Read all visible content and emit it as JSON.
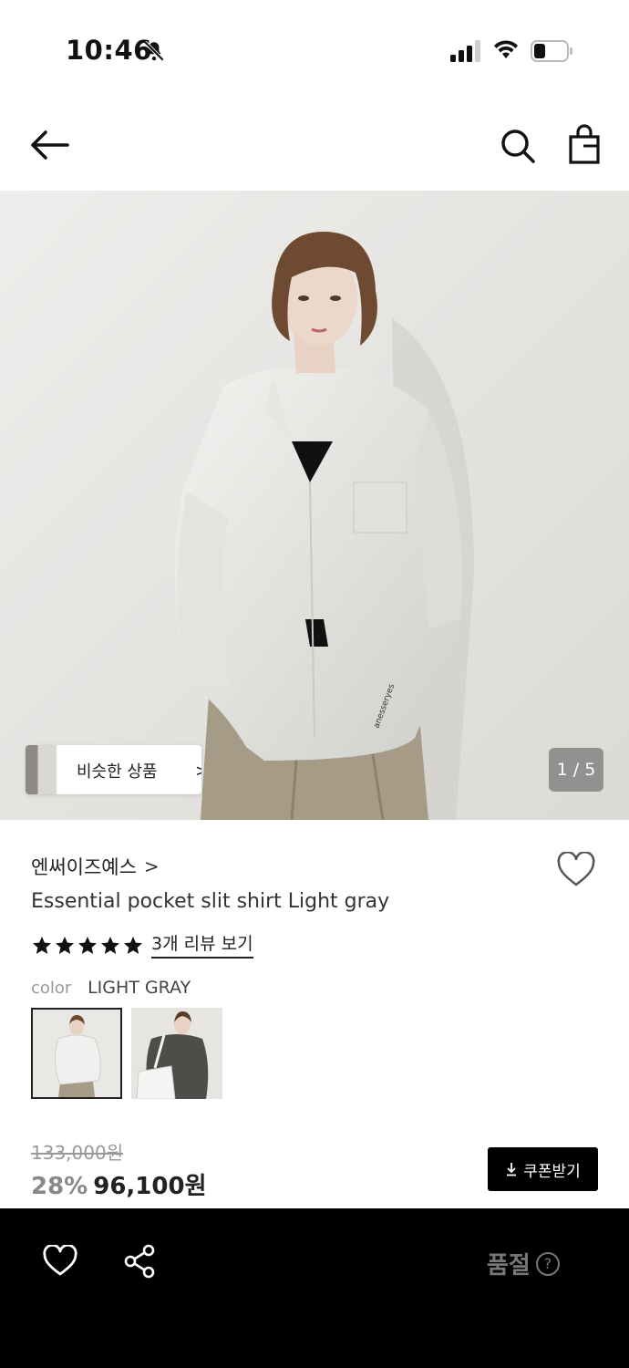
{
  "status_bar": {
    "time": "10:46",
    "icons": [
      "bell-slash-icon",
      "signal-icon",
      "wifi-icon",
      "battery-icon"
    ]
  },
  "header": {
    "icons": [
      "arrow-left-icon",
      "search-icon",
      "shopping-bag-icon"
    ]
  },
  "hero": {
    "similar_label": "비슷한 상품",
    "similar_chevron": ">",
    "page_indicator": "1 / 5"
  },
  "product": {
    "brand": "엔써이즈예스",
    "brand_chevron": ">",
    "title": "Essential pocket slit shirt Light gray",
    "rating_stars": 5,
    "review_link": "3개 리뷰 보기",
    "color_label": "color",
    "color_value": "LIGHT GRAY",
    "original_price": "133,000원",
    "discount": "28%",
    "sale_price": "96,100원",
    "coupon_label": "쿠폰받기"
  },
  "bottom_bar": {
    "status_label": "품절",
    "help_symbol": "?"
  },
  "colors": {
    "accent": "#000000",
    "muted_text": "#999999",
    "background": "#ffffff"
  }
}
